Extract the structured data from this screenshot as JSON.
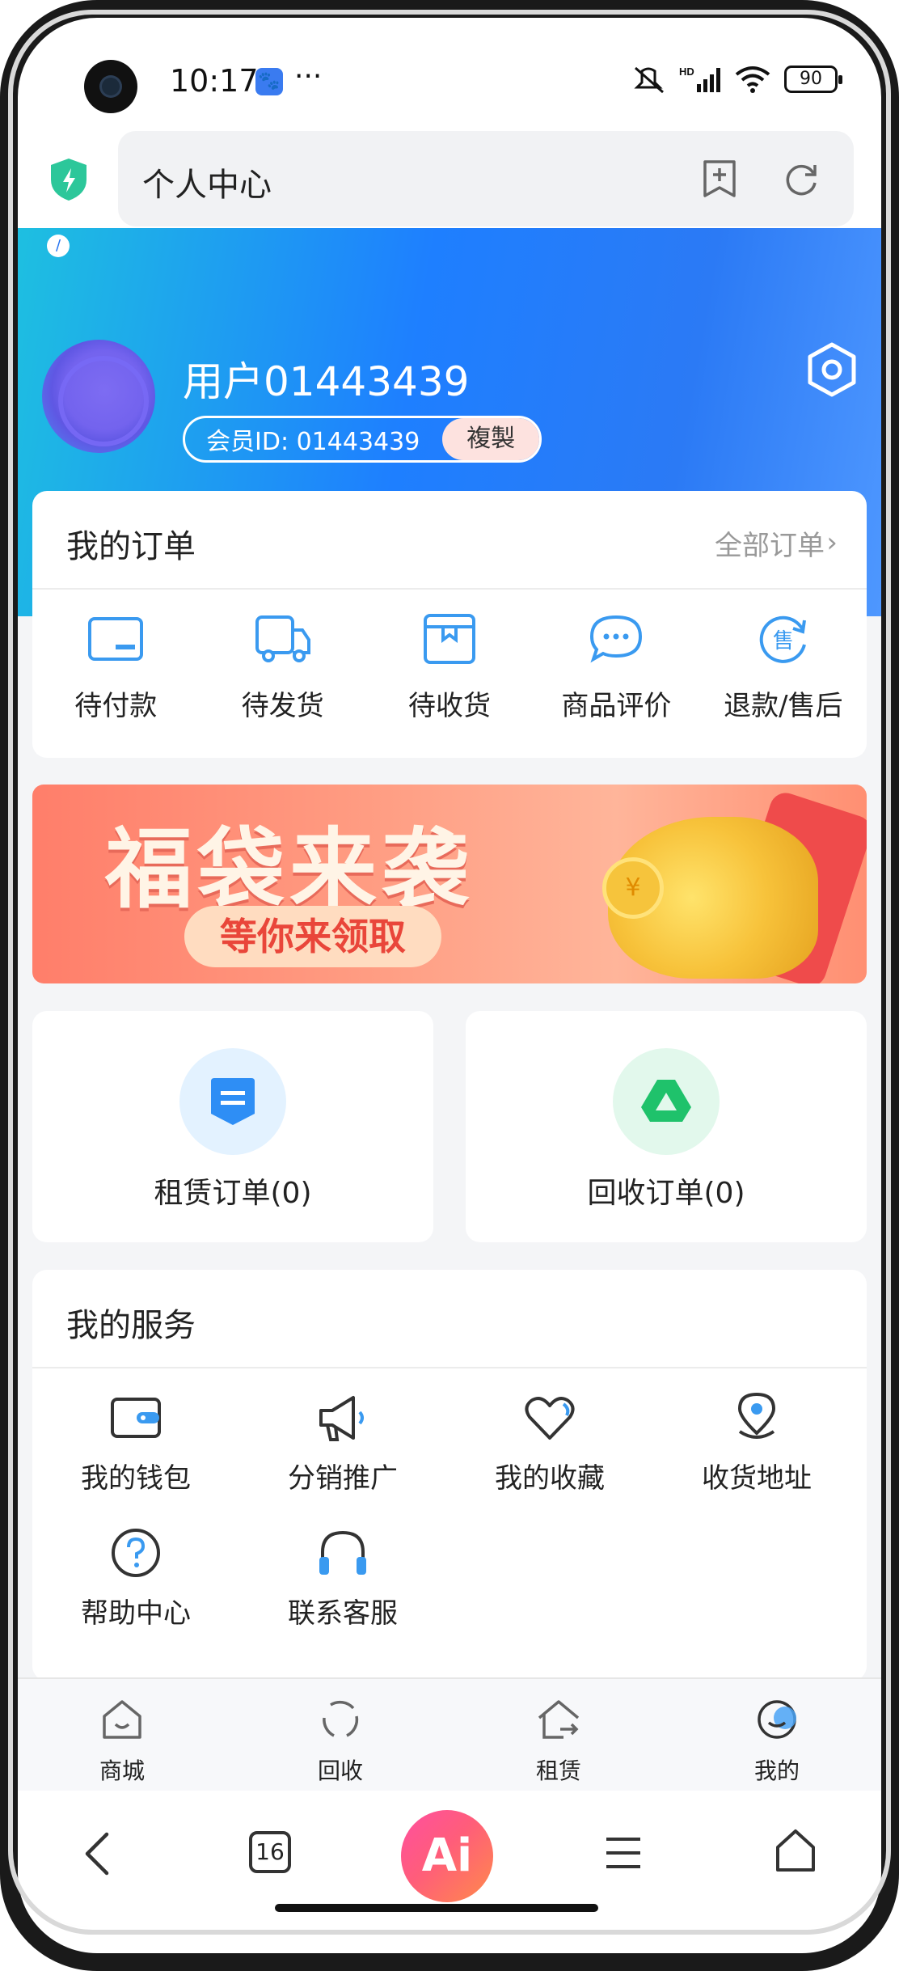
{
  "status_bar": {
    "time": "10:17",
    "dots": "···",
    "battery": "90"
  },
  "address_bar": {
    "title": "个人中心"
  },
  "profile": {
    "username": "用户01443439",
    "member_id": "会员ID: 01443439",
    "copy_label": "複製"
  },
  "orders": {
    "title": "我的订单",
    "all_label": "全部订单",
    "items": [
      {
        "label": "待付款",
        "icon": "card-icon"
      },
      {
        "label": "待发货",
        "icon": "truck-icon"
      },
      {
        "label": "待收货",
        "icon": "box-icon"
      },
      {
        "label": "商品评价",
        "icon": "chat-icon"
      },
      {
        "label": "退款/售后",
        "icon": "after-sale-icon"
      }
    ]
  },
  "banner": {
    "title": "福袋来袭",
    "subtitle": "等你来领取"
  },
  "quick_orders": {
    "rent_label": "租赁订单(0)",
    "recycle_label": "回收订单(0)"
  },
  "services": {
    "title": "我的服务",
    "items": [
      {
        "label": "我的钱包",
        "icon": "wallet-icon"
      },
      {
        "label": "分销推广",
        "icon": "megaphone-icon"
      },
      {
        "label": "我的收藏",
        "icon": "heart-icon"
      },
      {
        "label": "收货地址",
        "icon": "location-icon"
      },
      {
        "label": "帮助中心",
        "icon": "help-icon"
      },
      {
        "label": "联系客服",
        "icon": "headset-icon"
      }
    ]
  },
  "tabbar": {
    "items": [
      {
        "label": "商城",
        "icon": "store-icon"
      },
      {
        "label": "回收",
        "icon": "recycle-icon"
      },
      {
        "label": "租赁",
        "icon": "rent-house-icon"
      },
      {
        "label": "我的",
        "icon": "profile-icon"
      }
    ]
  },
  "browser_nav": {
    "tab_count": "16",
    "ai_label": "Ai"
  },
  "colors": {
    "accent_blue": "#1e7fff",
    "teal": "#1ec0e0",
    "banner_red": "#ff7e6a",
    "copy_bg": "#fde2df"
  }
}
